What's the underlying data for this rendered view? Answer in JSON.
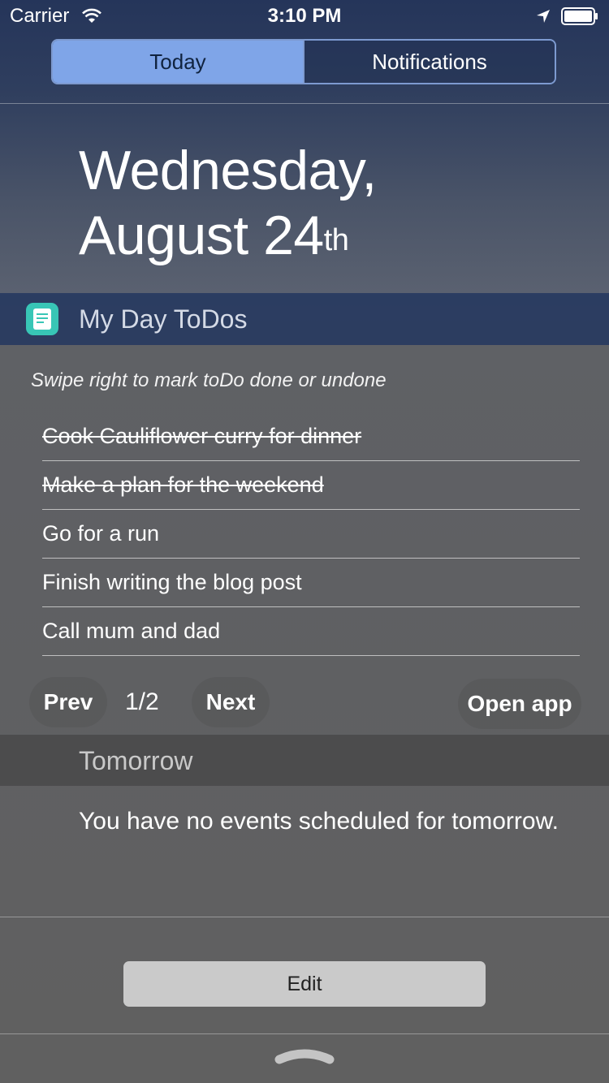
{
  "status_bar": {
    "carrier": "Carrier",
    "time": "3:10 PM",
    "icons": [
      "wifi-icon",
      "location-arrow-icon",
      "battery-icon"
    ]
  },
  "segmented_control": {
    "tabs": [
      {
        "label": "Today",
        "selected": true
      },
      {
        "label": "Notifications",
        "selected": false
      }
    ]
  },
  "date": {
    "line1": "Wednesday,",
    "line2": "August 24",
    "suffix": "th"
  },
  "widget": {
    "title": "My Day ToDos",
    "icon": "notepad-app-icon",
    "hint": "Swipe right to mark toDo done or undone",
    "todos": [
      {
        "text": "Cook Cauliflower curry for dinner",
        "done": true
      },
      {
        "text": "Make a plan for the weekend",
        "done": true
      },
      {
        "text": "Go for a run",
        "done": false
      },
      {
        "text": "Finish writing the blog post",
        "done": false
      },
      {
        "text": "Call mum and dad",
        "done": false
      }
    ],
    "pager": {
      "prev_label": "Prev",
      "page": "1/2",
      "next_label": "Next",
      "open_app_label": "Open app"
    }
  },
  "tomorrow": {
    "title": "Tomorrow",
    "message": "You have no events scheduled for tomorrow."
  },
  "edit_label": "Edit",
  "colors": {
    "segment_active": "#7fa5e8",
    "app_icon": "#38c6b6",
    "edit_button": "#cacaca"
  }
}
